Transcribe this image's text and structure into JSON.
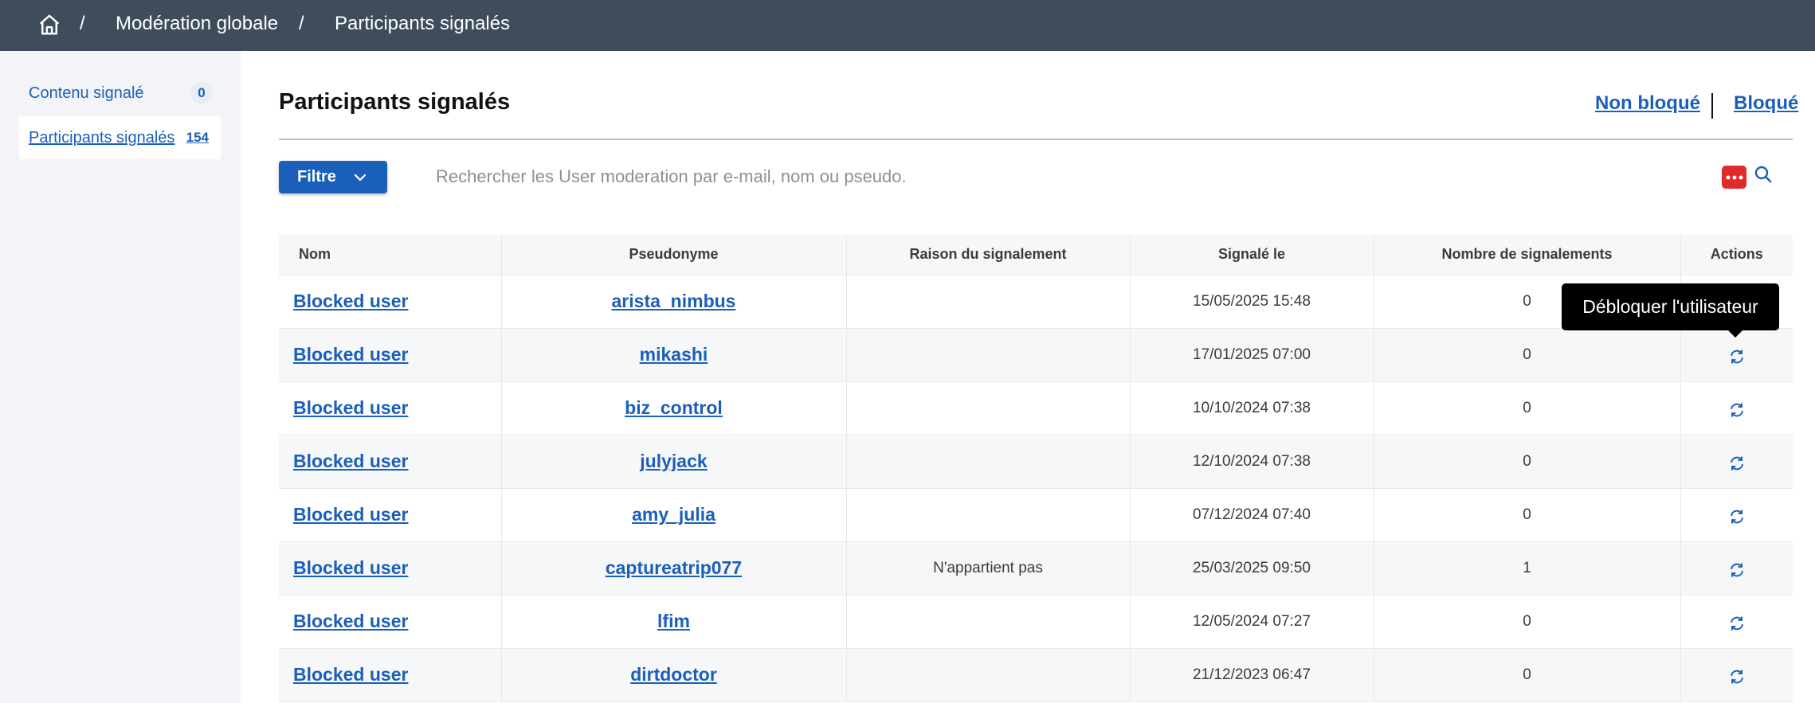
{
  "breadcrumb": {
    "items": [
      "Modération globale",
      "Participants signalés"
    ],
    "separator": "/"
  },
  "sidebar": {
    "items": [
      {
        "label": "Contenu signalé",
        "count": "0"
      },
      {
        "label": "Participants signalés",
        "count": "154"
      }
    ]
  },
  "main": {
    "title": "Participants signalés",
    "toggle": {
      "unblocked": "Non bloqué",
      "blocked": "Bloqué"
    },
    "filter_label": "Filtre",
    "search_placeholder": "Rechercher les User moderation par e-mail, nom ou pseudo."
  },
  "table": {
    "headers": [
      "Nom",
      "Pseudonyme",
      "Raison du signalement",
      "Signalé le",
      "Nombre de signalements",
      "Actions"
    ],
    "rows": [
      {
        "name": "Blocked user",
        "nickname": "arista_nimbus",
        "reason": "",
        "reported_at": "15/05/2025 15:48",
        "count": "0"
      },
      {
        "name": "Blocked user",
        "nickname": "mikashi",
        "reason": "",
        "reported_at": "17/01/2025 07:00",
        "count": "0"
      },
      {
        "name": "Blocked user",
        "nickname": "biz_control",
        "reason": "",
        "reported_at": "10/10/2024 07:38",
        "count": "0"
      },
      {
        "name": "Blocked user",
        "nickname": "julyjack",
        "reason": "",
        "reported_at": "12/10/2024 07:38",
        "count": "0"
      },
      {
        "name": "Blocked user",
        "nickname": "amy_julia",
        "reason": "",
        "reported_at": "07/12/2024 07:40",
        "count": "0"
      },
      {
        "name": "Blocked user",
        "nickname": "captureatrip077",
        "reason": "N'appartient pas",
        "reported_at": "25/03/2025 09:50",
        "count": "1"
      },
      {
        "name": "Blocked user",
        "nickname": "lfim",
        "reason": "",
        "reported_at": "12/05/2024 07:27",
        "count": "0"
      },
      {
        "name": "Blocked user",
        "nickname": "dirtdoctor",
        "reason": "",
        "reported_at": "21/12/2023 06:47",
        "count": "0"
      }
    ],
    "action_icon": "refresh-icon"
  },
  "tooltip": {
    "text": "Débloquer l'utilisateur"
  },
  "icons": {
    "home": "home-icon",
    "filter_chevron": "chevron-down-icon",
    "search": "search-icon",
    "extension": "extension-icon"
  },
  "colors": {
    "topbar": "#3e4c5c",
    "accent": "#1a5fba",
    "sidebar_bg": "#f3f4f7",
    "extension_red": "#e02b2b",
    "tooltip_bg": "#000000"
  }
}
